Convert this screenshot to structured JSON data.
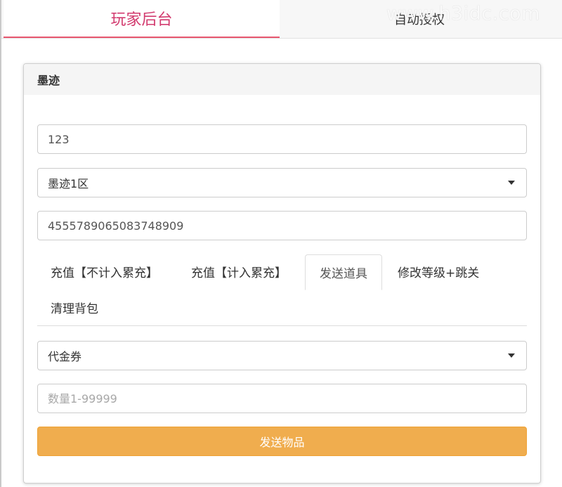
{
  "top_tabs": {
    "player_admin": "玩家后台",
    "auto_auth": "自动授权"
  },
  "watermark": "www.h3idc.com",
  "panel": {
    "title": "墨迹",
    "account_value": "123",
    "server_select": {
      "selected": "墨迹1区"
    },
    "id_value": "4555789065083748909",
    "tabs": [
      {
        "label": "充值【不计入累充】",
        "active": false
      },
      {
        "label": "充值【计入累充】",
        "active": false
      },
      {
        "label": "发送道具",
        "active": true
      },
      {
        "label": "修改等级+跳关",
        "active": false
      },
      {
        "label": "清理背包",
        "active": false
      }
    ],
    "item_select": {
      "selected": "代金券"
    },
    "quantity_placeholder": "数量1-99999",
    "send_button": "发送物品"
  }
}
